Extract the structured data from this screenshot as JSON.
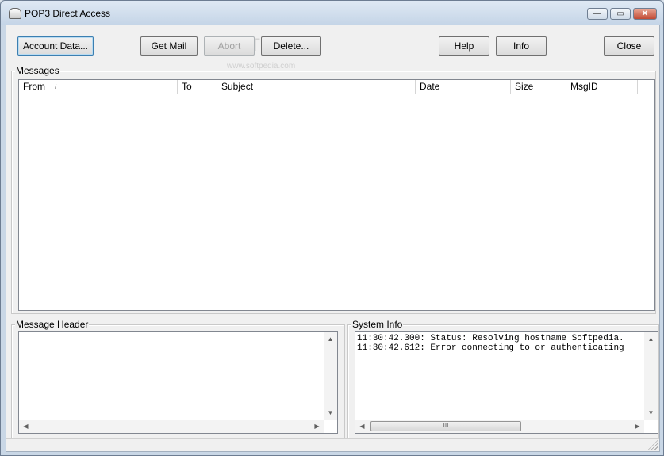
{
  "window": {
    "title": "POP3 Direct Access",
    "icon": "mail-app-icon",
    "controls": {
      "minimize": "—",
      "maximize": "▭",
      "close": "✕"
    }
  },
  "toolbar": {
    "account_data": "Account Data...",
    "get_mail": "Get Mail",
    "abort": "Abort",
    "delete": "Delete...",
    "help": "Help",
    "info": "Info",
    "close": "Close"
  },
  "watermark": {
    "logo": "SOFTPEDIA",
    "url": "www.softpedia.com"
  },
  "messages": {
    "label": "Messages",
    "columns": [
      "From",
      "To",
      "Subject",
      "Date",
      "Size",
      "MsgID"
    ],
    "sort_indicator": "/",
    "rows": []
  },
  "message_header": {
    "label": "Message Header",
    "content": ""
  },
  "system_info": {
    "label": "System Info",
    "lines": [
      "11:30:42.300: Status: Resolving hostname Softpedia.",
      "11:30:42.612: Error connecting to or authenticating"
    ]
  },
  "scroll": {
    "up": "▲",
    "down": "▼",
    "left": "◀",
    "right": "▶",
    "thumb_grip": "III"
  }
}
